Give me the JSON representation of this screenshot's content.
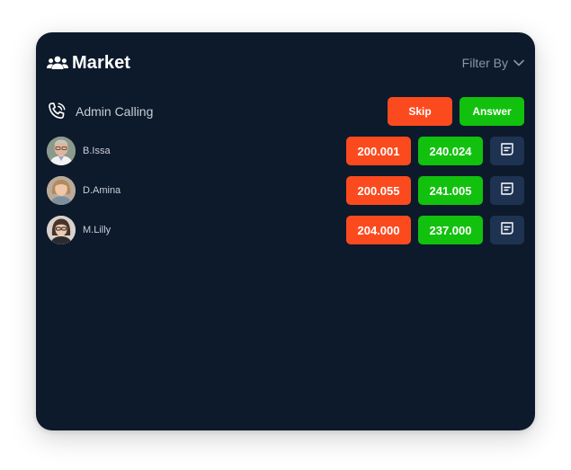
{
  "header": {
    "title": "Market",
    "title_icon": "users-icon",
    "filter_label": "Filter By",
    "filter_icon": "chevron-down-icon"
  },
  "call": {
    "icon": "phone-ringing-icon",
    "label": "Admin Calling",
    "skip_label": "Skip",
    "answer_label": "Answer"
  },
  "traders": [
    {
      "name": "B.Issa",
      "sell": "200.001",
      "buy": "240.024",
      "action_icon": "message-icon"
    },
    {
      "name": "D.Amina",
      "sell": "200.055",
      "buy": "241.005",
      "action_icon": "message-icon"
    },
    {
      "name": "M.Lilly",
      "sell": "204.000",
      "buy": "237.000",
      "action_icon": "message-icon"
    }
  ],
  "colors": {
    "card_bg": "#0d1a2b",
    "sell": "#fc4a1f",
    "buy": "#12c10e",
    "action_bg": "#1e3352",
    "muted_text": "#8b95a3"
  }
}
